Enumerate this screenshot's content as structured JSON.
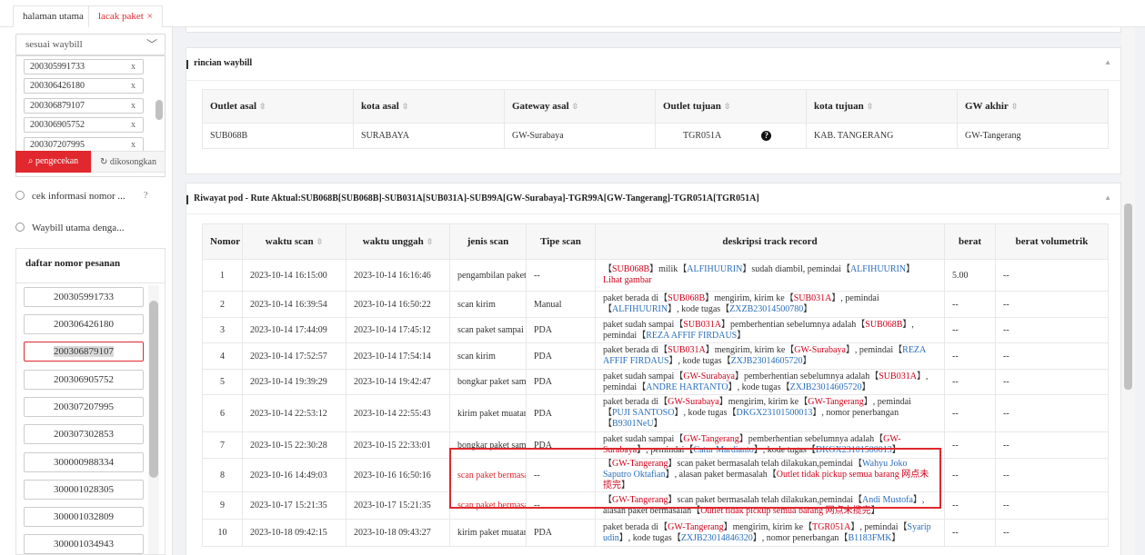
{
  "tabs": [
    {
      "label": "halaman utama"
    },
    {
      "label": "lacak paket",
      "close": "×"
    }
  ],
  "left": {
    "select_label": "sesuai waybill",
    "waybills": [
      "200305991733",
      "200306426180",
      "200306879107",
      "200306905752",
      "200307207995"
    ],
    "remove_glyph": "x",
    "check_button": "pengecekan",
    "clear_button": "dikosongkan",
    "radio_options": [
      "cek informasi nomor ...",
      "Waybill utama denga..."
    ],
    "order_title": "daftar nomor pesanan",
    "orders": [
      "200305991733",
      "200306426180",
      "200306879107",
      "200306905752",
      "200307207995",
      "200307302853",
      "300000988334",
      "300001028305",
      "300001032809",
      "300001034943"
    ],
    "selected_order": "200306879107"
  },
  "waybill_detail": {
    "title": "rincian waybill",
    "headers": [
      "Outlet asal",
      "kota asal",
      "Gateway asal",
      "Outlet tujuan",
      "kota tujuan",
      "GW akhir"
    ],
    "row": [
      "SUB068B",
      "SURABAYA",
      "GW-Surabaya",
      "TGR051A",
      "KAB. TANGERANG",
      "GW-Tangerang"
    ]
  },
  "pod_history": {
    "title": "Riwayat pod - Rute Aktual:SUB068B[SUB068B]-SUB031A[SUB031A]-SUB99A[GW-Surabaya]-TGR99A[GW-Tangerang]-TGR051A[TGR051A]",
    "headers": [
      "Nomor",
      "waktu scan",
      "waktu unggah",
      "jenis scan",
      "Tipe scan",
      "deskripsi track record",
      "berat",
      "berat volumetrik"
    ],
    "rows": [
      {
        "no": "1",
        "scan": "2023-10-14 16:15:00",
        "upload": "2023-10-14 16:16:46",
        "type": "pengambilan paket",
        "tipe": "--",
        "berat": "5.00",
        "vol": "--"
      },
      {
        "no": "2",
        "scan": "2023-10-14 16:39:54",
        "upload": "2023-10-14 16:50:22",
        "type": "scan kirim",
        "tipe": "Manual",
        "berat": "--",
        "vol": "--"
      },
      {
        "no": "3",
        "scan": "2023-10-14 17:44:09",
        "upload": "2023-10-14 17:45:12",
        "type": "scan paket sampai",
        "tipe": "PDA",
        "berat": "--",
        "vol": "--"
      },
      {
        "no": "4",
        "scan": "2023-10-14 17:52:57",
        "upload": "2023-10-14 17:54:14",
        "type": "scan kirim",
        "tipe": "PDA",
        "berat": "--",
        "vol": "--"
      },
      {
        "no": "5",
        "scan": "2023-10-14 19:39:29",
        "upload": "2023-10-14 19:42:47",
        "type": "bongkar paket samp",
        "tipe": "PDA",
        "berat": "--",
        "vol": "--"
      },
      {
        "no": "6",
        "scan": "2023-10-14 22:53:12",
        "upload": "2023-10-14 22:55:43",
        "type": "kirim paket muatan",
        "tipe": "PDA",
        "berat": "--",
        "vol": "--"
      },
      {
        "no": "7",
        "scan": "2023-10-15 22:30:28",
        "upload": "2023-10-15 22:33:01",
        "type": "bongkar paket samp",
        "tipe": "PDA",
        "berat": "--",
        "vol": "--"
      },
      {
        "no": "8",
        "scan": "2023-10-16 14:49:03",
        "upload": "2023-10-16 16:50:16",
        "type": "scan paket bermasa",
        "tipe": "--",
        "berat": "--",
        "vol": "--"
      },
      {
        "no": "9",
        "scan": "2023-10-17 15:21:35",
        "upload": "2023-10-17 15:21:35",
        "type": "scan paket bermasa",
        "tipe": "--",
        "berat": "--",
        "vol": "--"
      },
      {
        "no": "10",
        "scan": "2023-10-18 09:42:15",
        "upload": "2023-10-18 09:43:27",
        "type": "kirim paket muatan",
        "tipe": "PDA",
        "berat": "--",
        "vol": "--"
      }
    ],
    "desc": {
      "d1": {
        "a": "【",
        "b": "SUB068B",
        "c": "】milik【",
        "d": "ALFIHUURIN",
        "e": "】sudah diambil, pemindai【",
        "f": "ALFIHUURIN",
        "g": "】",
        "h": "Lihat gambar"
      },
      "d2": {
        "a": "paket berada di【",
        "b": "SUB068B",
        "c": "】mengirim, kirim ke【",
        "d": "SUB031A",
        "e": "】, pemindai【",
        "f": "ALFIHUURIN",
        "g": "】, kode tugas【",
        "h": "ZXZB23014500780",
        "i": "】"
      },
      "d3": {
        "a": "paket sudah sampai【",
        "b": "SUB031A",
        "c": "】pemberhentian sebelumnya adalah【",
        "d": "SUB068B",
        "e": "】, pemindai【",
        "f": "REZA AFFIF FIRDAUS",
        "g": "】"
      },
      "d4": {
        "a": "paket berada di【",
        "b": "SUB031A",
        "c": "】mengirim, kirim ke【",
        "d": "GW-Surabaya",
        "e": "】, pemindai【",
        "f": "REZA AFFIF FIRDAUS",
        "g": "】, kode tugas【",
        "h": "ZXJB23014605720",
        "i": "】"
      },
      "d5": {
        "a": "paket sudah sampai【",
        "b": "GW-Surabaya",
        "c": "】pemberhentian sebelumnya adalah【",
        "d": "SUB031A",
        "e": "】, pemindai【",
        "f": "ANDRE HARTANTO",
        "g": "】, kode tugas【",
        "h": "ZXJB23014605720",
        "i": "】"
      },
      "d6": {
        "a": "paket berada di【",
        "b": "GW-Surabaya",
        "c": "】mengirim, kirim ke【",
        "d": "GW-Tangerang",
        "e": "】, pemindai【",
        "f": "PUJI SANTOSO",
        "g": "】, kode tugas【",
        "h": "DKGX23101500013",
        "i": "】, nomor penerbangan【",
        "j": "B9301NeU",
        "k": "】"
      },
      "d7": {
        "a": "paket sudah sampai【",
        "b": "GW-Tangerang",
        "c": "】pemberhentian sebelumnya adalah【",
        "d": "GW-Surabaya",
        "e": "】, pemindai【",
        "f": "Catur Mardianto",
        "g": "】, kode tugas【",
        "h": "DKGX23101500013",
        "i": "】"
      },
      "d8": {
        "a": "【",
        "b": "GW-Tangerang",
        "c": "】scan paket bermasalah telah dilakukan,pemindai【",
        "d": "Wahyu Joko Saputro Oktafian",
        "e": "】, alasan paket bermasalah【",
        "f": "Outlet tidak pickup semua barang 网点未揽完",
        "g": "】"
      },
      "d9": {
        "a": "【",
        "b": "GW-Tangerang",
        "c": "】scan paket bermasalah telah dilakukan,pemindai【",
        "d": "Andi Mustofa",
        "e": "】, alasan paket bermasalah【",
        "f": "Outlet tidak pickup semua barang 网点未揽完",
        "g": "】"
      },
      "d10": {
        "a": "paket berada di【",
        "b": "GW-Tangerang",
        "c": "】mengirim, kirim ke【",
        "d": "TGR051A",
        "e": "】, pemindai【",
        "f": "Syarip udin",
        "g": "】, kode tugas【",
        "h": "ZXJB23014846320",
        "i": "】, nomor penerbangan【",
        "j": "B1183FMK",
        "k": "】"
      }
    }
  }
}
